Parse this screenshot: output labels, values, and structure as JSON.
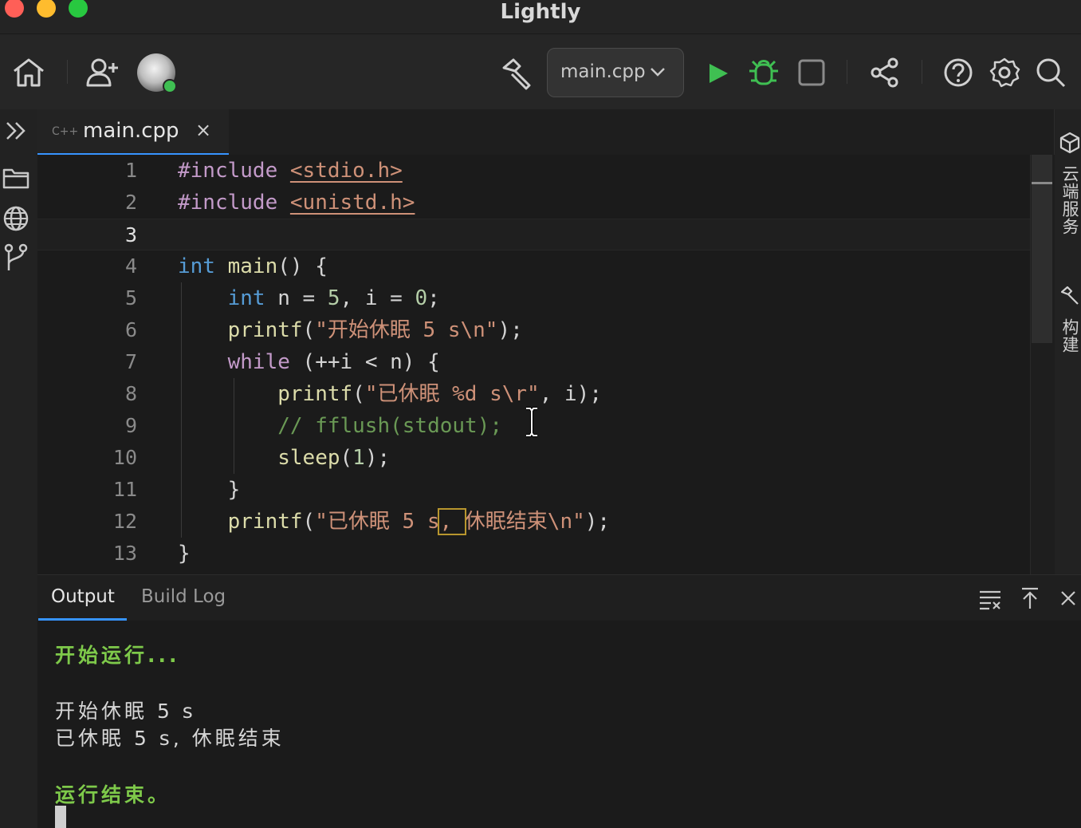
{
  "window": {
    "title": "Lightly"
  },
  "toolbar": {
    "run_target": "main.cpp",
    "icons": [
      "home-icon",
      "add-user-icon",
      "avatar",
      "hammer-icon",
      "chevron-down-icon",
      "run-icon",
      "debug-icon",
      "stop-icon",
      "share-icon",
      "help-icon",
      "settings-icon",
      "search-icon"
    ]
  },
  "right_bar": {
    "cloud_label": "云端服务",
    "build_label": "构建"
  },
  "editor": {
    "tab_icon": "C++",
    "tab_label": "main.cpp",
    "tab_close": "×",
    "line_numbers": [
      "1",
      "2",
      "3",
      "4",
      "5",
      "6",
      "7",
      "8",
      "9",
      "10",
      "11",
      "12",
      "13"
    ],
    "current_line": 3,
    "lines": [
      "#include <stdio.h>",
      "#include <unistd.h>",
      "",
      "int main() {",
      "    int n = 5, i = 0;",
      "    printf(\"开始休眠 5 s\\n\");",
      "    while (++i < n) {",
      "        printf(\"已休眠 %d s\\r\", i);",
      "        // fflush(stdout);",
      "        sleep(1);",
      "    }",
      "    printf(\"已休眠 5 s, 休眠结束\\n\");",
      "}"
    ]
  },
  "panel": {
    "tabs": [
      {
        "label": "Output",
        "active": true
      },
      {
        "label": "Build Log",
        "active": false
      }
    ],
    "output": {
      "start": "开始运行...",
      "line1": "开始休眠 5 s",
      "line2": "已休眠 5 s, 休眠结束",
      "end": "运行结束。"
    }
  },
  "colors": {
    "accent": "#3794ff",
    "run_green": "#3fbf52",
    "output_green": "#7ec94a"
  }
}
